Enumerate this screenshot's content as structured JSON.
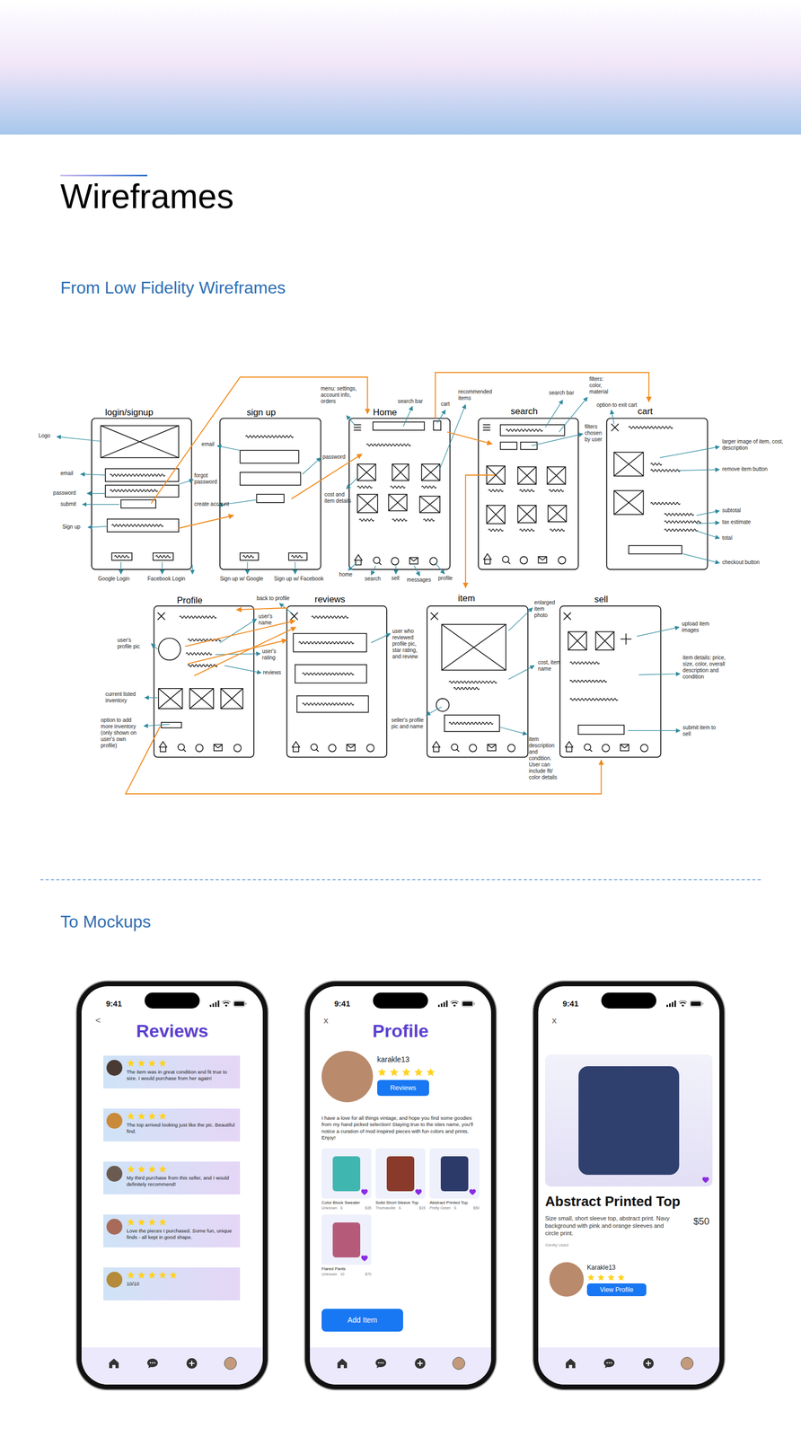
{
  "page": {
    "title": "Wireframes",
    "section_from": "From Low Fidelity Wireframes",
    "section_to": "To Mockups"
  },
  "wireframes": {
    "frames": [
      {
        "title": "login/signup",
        "kind": "login"
      },
      {
        "title": "sign up",
        "kind": "signup"
      },
      {
        "title": "Home",
        "kind": "home"
      },
      {
        "title": "search",
        "kind": "search"
      },
      {
        "title": "cart",
        "kind": "cart"
      },
      {
        "title": "Profile",
        "kind": "profile"
      },
      {
        "title": "reviews",
        "kind": "reviews"
      },
      {
        "title": "item",
        "kind": "item"
      },
      {
        "title": "sell",
        "kind": "sell"
      }
    ],
    "notes": [
      {
        "text": "Logo"
      },
      {
        "text": "email"
      },
      {
        "text": "password"
      },
      {
        "text": "submit"
      },
      {
        "text": "Sign up"
      },
      {
        "text": "Google Login"
      },
      {
        "text": "Facebook Login"
      },
      {
        "text": "email"
      },
      {
        "text": "forgot password"
      },
      {
        "text": "create account"
      },
      {
        "text": "Sign up w/ Google"
      },
      {
        "text": "Sign up w/ Facebook"
      },
      {
        "text": "password"
      },
      {
        "text": "menu: settings, account info, orders"
      },
      {
        "text": "search bar"
      },
      {
        "text": "cart"
      },
      {
        "text": "recommended items"
      },
      {
        "text": "cost and item details"
      },
      {
        "text": "home"
      },
      {
        "text": "search"
      },
      {
        "text": "sell"
      },
      {
        "text": "messages"
      },
      {
        "text": "profile"
      },
      {
        "text": "search bar"
      },
      {
        "text": "filters: color, material"
      },
      {
        "text": "option to exit cart"
      },
      {
        "text": "filters chosen by user"
      },
      {
        "text": "larger image of item, cost, description"
      },
      {
        "text": "remove item button"
      },
      {
        "text": "subtotal"
      },
      {
        "text": "tax estimate"
      },
      {
        "text": "total"
      },
      {
        "text": "checkout button"
      },
      {
        "text": "back to profile"
      },
      {
        "text": "user's profile pic"
      },
      {
        "text": "user's name"
      },
      {
        "text": "user's rating"
      },
      {
        "text": "reviews"
      },
      {
        "text": "current listed inventory"
      },
      {
        "text": "option to add more inventory (only shown on user's own profile)"
      },
      {
        "text": "user who reviewed profile pic, star rating, and review"
      },
      {
        "text": "enlarged item photo"
      },
      {
        "text": "cost, item name"
      },
      {
        "text": "seller's profile pic and name"
      },
      {
        "text": "item description and condition. User can include fit/ color details"
      },
      {
        "text": "upload item images"
      },
      {
        "text": "item details: price, size, color, overall description and condition"
      },
      {
        "text": "submit item to sell"
      }
    ]
  },
  "mockups": [
    {
      "kind": "reviews",
      "time": "9:41",
      "nav_glyph": "<",
      "title": "Reviews",
      "reviews": [
        {
          "stars": 4,
          "text": "The item was in great condition and fit true to size. I would purchase from her again!"
        },
        {
          "stars": 4,
          "text": "The top arrived looking just like the pic. Beautiful find."
        },
        {
          "stars": 4,
          "text": "My third purchase from this seller, and I would definitely recommend!"
        },
        {
          "stars": 4,
          "text": "Love the pieces I purchased. Some fun, unique finds - all kept in good shape."
        },
        {
          "stars": 5,
          "text": "10/10"
        }
      ]
    },
    {
      "kind": "profile",
      "time": "9:41",
      "nav_glyph": "x",
      "title": "Profile",
      "user": "karakle13",
      "stars": 5,
      "reviews_button": "Reviews",
      "bio": "I have a love for all things vintage, and hope you find some goodies from my hand picked selection! Staying true to the sites name, you'll notice a curation of mod inspired pieces with fun colors and prints. Enjoy!",
      "items": [
        {
          "name": "Color Block Sweater",
          "brand": "Unknown",
          "size": "S",
          "price": "$35",
          "liked": true
        },
        {
          "name": "Solid Short Sleeve Top",
          "brand": "Thomasville",
          "size": "S",
          "price": "$15",
          "liked": true
        },
        {
          "name": "Abstract Printed Top",
          "brand": "Pretty Green",
          "size": "S",
          "price": "$50",
          "liked": true
        },
        {
          "name": "Flared Pants",
          "brand": "Unknown",
          "size": "10",
          "price": "$70",
          "liked": true
        }
      ],
      "add_button": "Add Item"
    },
    {
      "kind": "item",
      "time": "9:41",
      "nav_glyph": "x",
      "item_title": "Abstract Printed Top",
      "price": "$50",
      "liked": true,
      "description": "Size small, short sleeve top, abstract print. Navy background with pink and orange sleeves and circle print.",
      "condition": "Gently Used",
      "seller": {
        "name": "Karakle13",
        "stars": 4,
        "button": "View Profile"
      }
    }
  ]
}
